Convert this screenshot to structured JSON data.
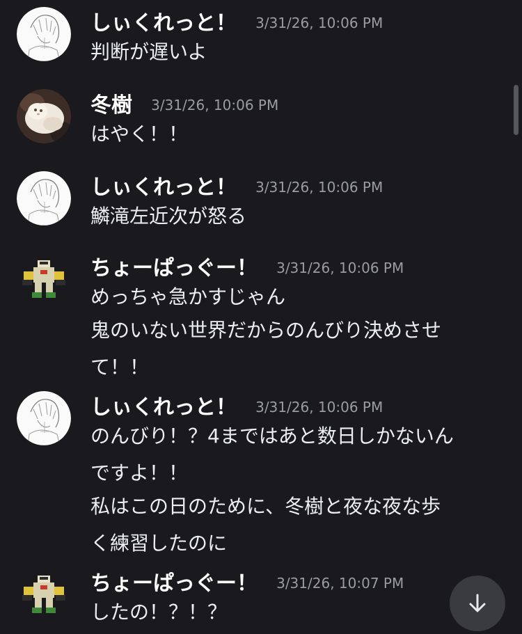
{
  "messages": [
    {
      "username": "しぃくれっと！",
      "timestamp": "3/31/26, 10:06 PM",
      "avatar_icon": "anime-sketch-avatar",
      "lines": [
        "判断が遅いよ"
      ]
    },
    {
      "username": "冬樹",
      "timestamp": "3/31/26, 10:06 PM",
      "avatar_icon": "fluffy-cat-avatar",
      "lines": [
        "はやく！！"
      ]
    },
    {
      "username": "しぃくれっと！",
      "timestamp": "3/31/26, 10:06 PM",
      "avatar_icon": "anime-sketch-avatar",
      "lines": [
        "鱗滝左近次が怒る"
      ]
    },
    {
      "username": "ちょーぱっぐー！",
      "timestamp": "3/31/26, 10:06 PM",
      "avatar_icon": "pixel-robot-avatar",
      "lines": [
        "めっちゃ急かすじゃん",
        "鬼のいない世界だからのんびり決めさせ",
        "て！！"
      ]
    },
    {
      "username": "しぃくれっと！",
      "timestamp": "3/31/26, 10:06 PM",
      "avatar_icon": "anime-sketch-avatar",
      "lines": [
        "のんびり！？4まではあと数日しかないん",
        "ですよ！！",
        "私はこの日のために、冬樹と夜な夜な歩",
        "く練習したのに"
      ]
    },
    {
      "username": "ちょーぱっぐー！",
      "timestamp": "3/31/26, 10:07 PM",
      "avatar_icon": "pixel-robot-avatar",
      "lines": [
        "したの！？！？"
      ]
    }
  ],
  "jump_button": {
    "icon": "arrow-down-icon"
  },
  "colors": {
    "background": "#1a1a1e",
    "username": "#ffffff",
    "message_text": "#eceef1",
    "timestamp": "#9a9ca4",
    "jump_button": "#3a3b40"
  }
}
